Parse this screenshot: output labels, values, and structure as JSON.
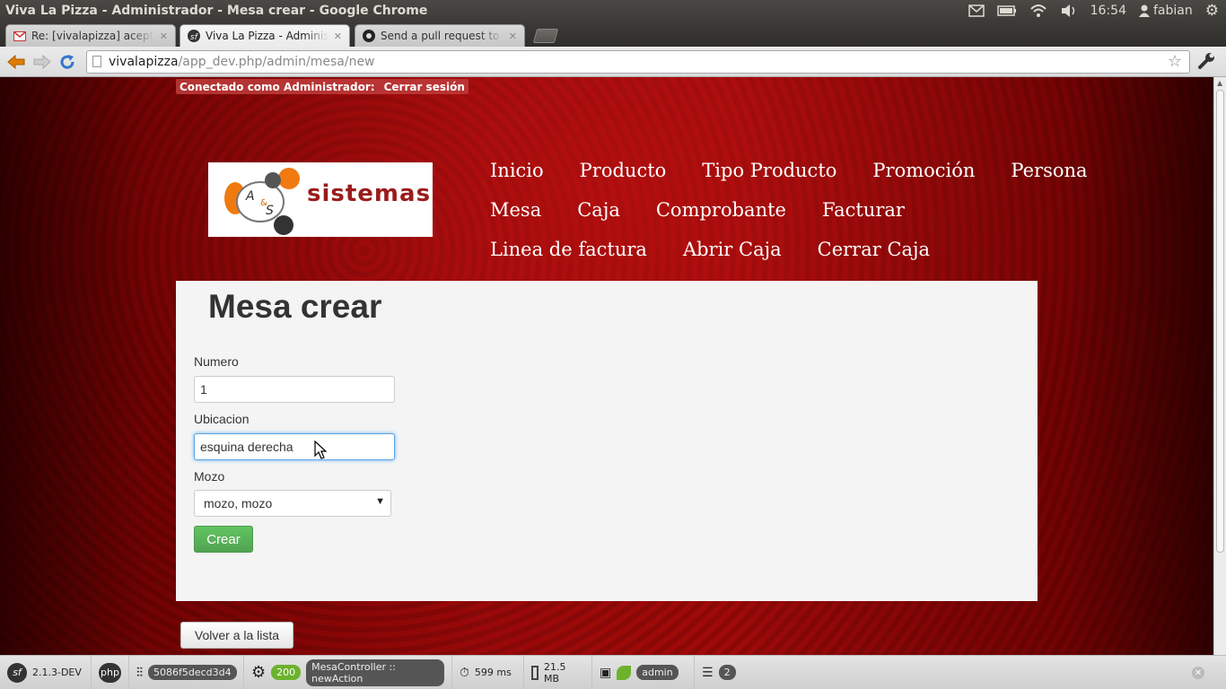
{
  "os_bar": {
    "title": "Viva La Pizza - Administrador - Mesa crear - Google Chrome",
    "time": "16:54",
    "user": "fabian"
  },
  "tabs": [
    {
      "title": "Re: [vivalapizza] aceptaaaa",
      "icon": "gmail-icon"
    },
    {
      "title": "Viva La Pizza - Administrador",
      "icon": "symfony-icon"
    },
    {
      "title": "Send a pull request to gonzalo",
      "icon": "github-icon"
    }
  ],
  "address_bar": {
    "host": "vivalapizza",
    "path": "/app_dev.php/admin/mesa/new"
  },
  "session": {
    "label": "Conectado como Administrador:",
    "logout": "Cerrar sesión"
  },
  "logo": {
    "text": "sistemas"
  },
  "nav": {
    "rows": [
      [
        "Inicio",
        "Producto",
        "Tipo Producto",
        "Promoción",
        "Persona"
      ],
      [
        "Mesa",
        "Caja",
        "Comprobante",
        "Facturar"
      ],
      [
        "Linea de factura",
        "Abrir Caja",
        "Cerrar Caja"
      ]
    ]
  },
  "form": {
    "title": "Mesa crear",
    "numero_label": "Numero",
    "numero_value": "1",
    "ubicacion_label": "Ubicacion",
    "ubicacion_value": "esquina derecha",
    "mozo_label": "Mozo",
    "mozo_value": "mozo, mozo",
    "submit": "Crear"
  },
  "back_link": "Volver a la lista",
  "debug_toolbar": {
    "version": "2.1.3-DEV",
    "php": "php",
    "token": "5086f5decd3d4",
    "status": "200",
    "controller": "MesaController",
    "action": "newAction",
    "time": "599 ms",
    "memory": "21.5 MB",
    "user": "admin",
    "queries": "2"
  },
  "colors": {
    "accent_green": "#5bb75b",
    "page_red": "#9a0a0a",
    "focus_blue": "#58a6e8"
  }
}
